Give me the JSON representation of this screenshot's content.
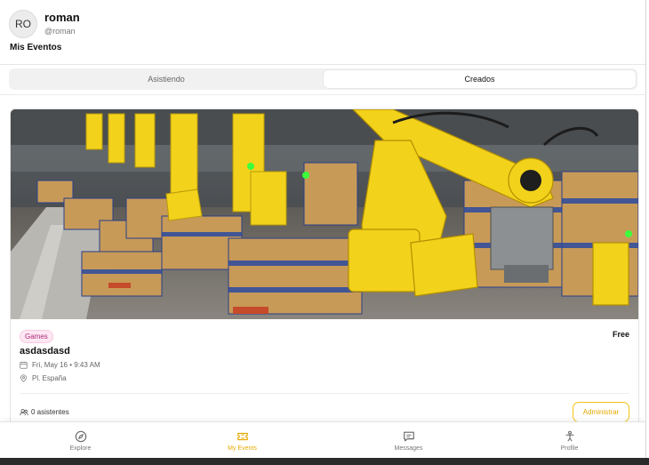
{
  "user": {
    "initials": "RO",
    "name": "roman",
    "handle": "@roman"
  },
  "page": {
    "title": "Mis Eventos"
  },
  "tabs": [
    {
      "label": "Asistiendo",
      "active": false
    },
    {
      "label": "Creados",
      "active": true
    }
  ],
  "event": {
    "category": "Games",
    "price": "Free",
    "title": "asdasdasd",
    "date": "Fri, May 16 • 9:43 AM",
    "location": "Pl. España",
    "attendees": "0 asistentes",
    "admin_label": "Administrar",
    "image_icon": "industrial-robot-arms-photo"
  },
  "nav": [
    {
      "label": "Explore",
      "icon": "compass-icon",
      "active": false
    },
    {
      "label": "My Events",
      "icon": "ticket-icon",
      "active": true
    },
    {
      "label": "Messages",
      "icon": "message-icon",
      "active": false
    },
    {
      "label": "Profile",
      "icon": "person-icon",
      "active": false
    }
  ],
  "colors": {
    "accent": "#f0c419",
    "badge_text": "#b02a7a",
    "badge_bg": "#fde7f3"
  }
}
